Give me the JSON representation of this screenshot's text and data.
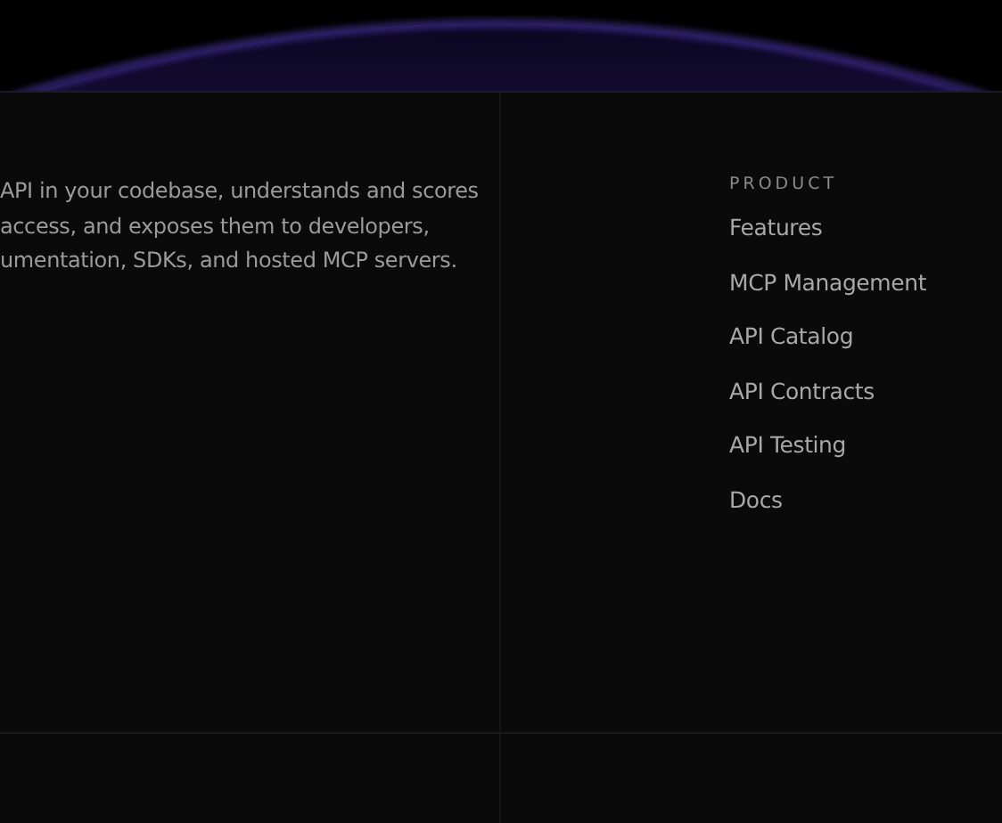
{
  "description": {
    "lines": [
      "API in your codebase, understands and scores",
      "access, and exposes them to developers,",
      "umentation, SDKs, and hosted MCP servers."
    ]
  },
  "product": {
    "heading": "PRODUCT",
    "links": [
      "Features",
      "MCP Management",
      "API Catalog",
      "API Contracts",
      "API Testing",
      "Docs"
    ]
  }
}
